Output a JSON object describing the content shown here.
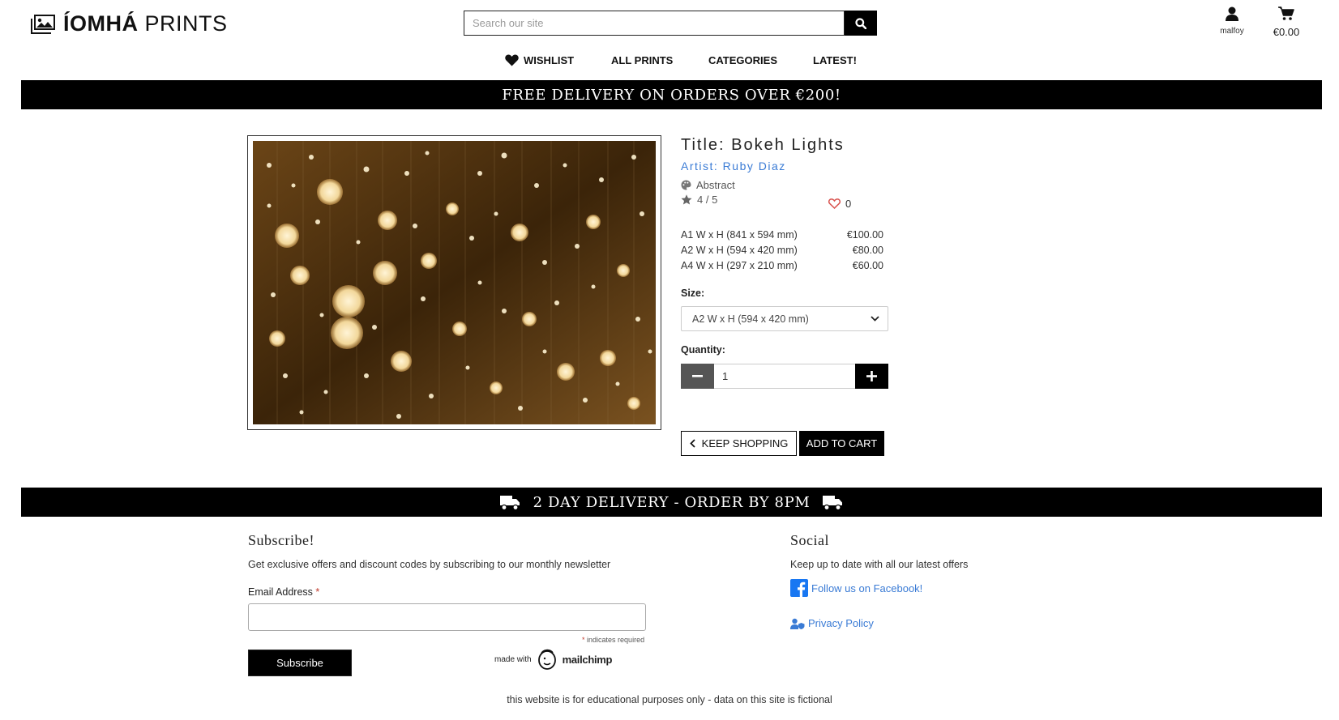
{
  "header": {
    "logo_bold": "ÍOMHÁ",
    "logo_light": "PRINTS",
    "search_placeholder": "Search our site",
    "account_label": "malfoy",
    "cart_total": "€0.00"
  },
  "nav": {
    "wishlist": "WISHLIST",
    "all_prints": "ALL PRINTS",
    "categories": "CATEGORIES",
    "latest": "LATEST!"
  },
  "banners": {
    "top": "FREE DELIVERY ON ORDERS OVER €200!",
    "bottom": "2 DAY DELIVERY - ORDER BY 8PM"
  },
  "product": {
    "title": "Title: Bokeh Lights",
    "artist": "Artist: Ruby Diaz",
    "category": "Abstract",
    "rating": "4 / 5",
    "likes": "0",
    "prices": [
      {
        "size": "A1 W x H (841 x 594 mm)",
        "price": "€100.00"
      },
      {
        "size": "A2 W x H (594 x 420 mm)",
        "price": "€80.00"
      },
      {
        "size": "A4 W x H (297 x 210 mm)",
        "price": "€60.00"
      }
    ],
    "size_label": "Size:",
    "size_selected": "A2 W x H (594 x 420 mm)",
    "quantity_label": "Quantity:",
    "quantity": "1",
    "keep_shopping": "KEEP SHOPPING",
    "add_to_cart": "ADD TO CART"
  },
  "footer": {
    "subscribe_heading": "Subscribe!",
    "subscribe_text": "Get exclusive offers and discount codes by subscribing to our monthly newsletter",
    "email_label": "Email Address",
    "required_mark": "*",
    "indicates_required": "indicates required",
    "subscribe_button": "Subscribe",
    "made_with": "made with",
    "mailchimp": "mailchimp",
    "social_heading": "Social",
    "social_text": "Keep up to date with all our latest offers",
    "facebook_link": "Follow us on Facebook!",
    "privacy_link": "Privacy Policy",
    "disclaimer": "this website is for educational purposes only - data on this site is fictional"
  },
  "colors": {
    "link": "#3a7bd5",
    "banner_bg": "#000000",
    "heart": "#d9534f"
  },
  "icons": [
    "images-icon",
    "search-icon",
    "user-icon",
    "cart-icon",
    "heart-icon",
    "palette-icon",
    "star-icon",
    "outline-heart-icon",
    "chevron-down-icon",
    "minus-icon",
    "plus-icon",
    "chevron-left-icon",
    "truck-icon",
    "facebook-icon",
    "user-shield-icon",
    "mailchimp-logo-icon"
  ]
}
